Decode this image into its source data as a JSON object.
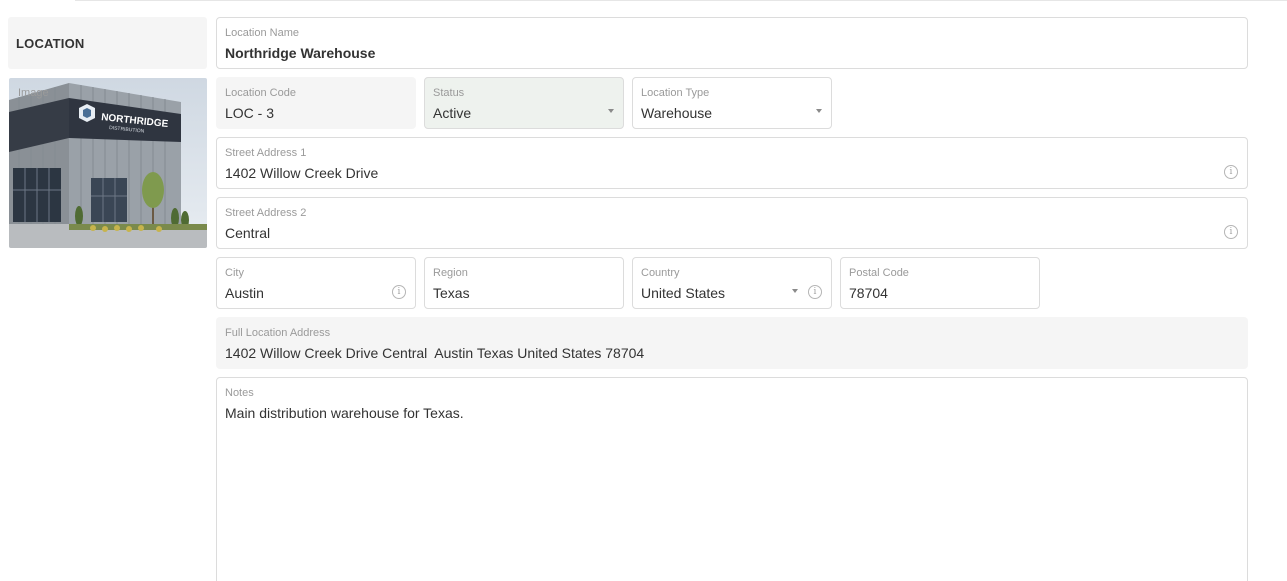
{
  "section": {
    "title": "LOCATION"
  },
  "image": {
    "label": "Image",
    "sign_text": "NORTHRIDGE",
    "sign_subtext": "DISTRIBUTION"
  },
  "fields": {
    "location_name": {
      "label": "Location Name",
      "value": "Northridge Warehouse"
    },
    "location_code": {
      "label": "Location Code",
      "value": "LOC - 3"
    },
    "status": {
      "label": "Status",
      "value": "Active"
    },
    "location_type": {
      "label": "Location Type",
      "value": "Warehouse"
    },
    "street_address_1": {
      "label": "Street Address 1",
      "value": "1402 Willow Creek Drive"
    },
    "street_address_2": {
      "label": "Street Address 2",
      "value": "Central"
    },
    "city": {
      "label": "City",
      "value": "Austin"
    },
    "region": {
      "label": "Region",
      "value": "Texas"
    },
    "country": {
      "label": "Country",
      "value": "United States"
    },
    "postal_code": {
      "label": "Postal Code",
      "value": "78704"
    },
    "full_address": {
      "label": "Full Location Address",
      "value": "1402 Willow Creek Drive Central  Austin Texas United States 78704"
    },
    "notes": {
      "label": "Notes",
      "value": "Main distribution warehouse for Texas."
    }
  },
  "icons": {
    "info": "info-circle-icon",
    "dropdown": "caret-down-icon"
  },
  "colors": {
    "field_border": "#dcdcdc",
    "readonly_bg": "#f5f5f5",
    "status_bg": "#eef2ee",
    "label": "#9a9a9a",
    "text": "#333333"
  }
}
